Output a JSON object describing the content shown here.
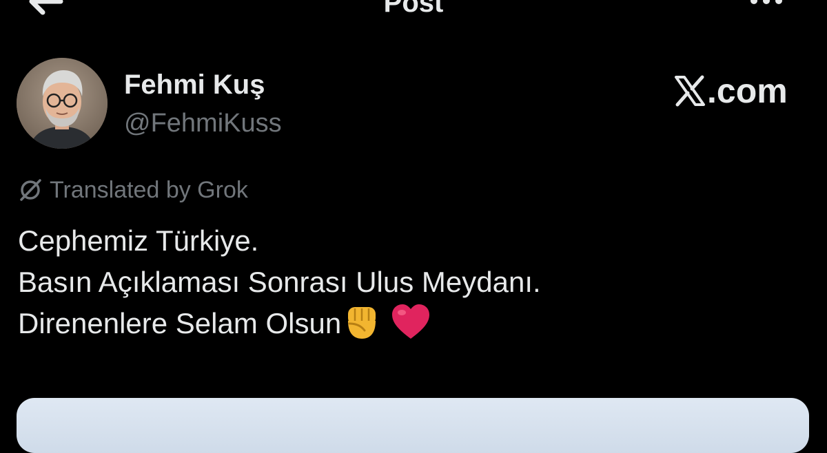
{
  "header": {
    "title": "Post",
    "back_icon": "arrow-left-icon",
    "more_icon": "ellipsis-icon"
  },
  "author": {
    "display_name": "Fehmi Kuş",
    "handle": "@FehmiKuss",
    "avatar_icon": "user-avatar"
  },
  "badge": {
    "logo_icon": "x-logo-icon",
    "label": ".com"
  },
  "translation": {
    "icon": "grok-icon",
    "label": "Translated by Grok"
  },
  "post": {
    "line1": "Cephemiz Türkiye.",
    "line2": "Basın Açıklaması Sonrası Ulus Meydanı.",
    "line3": "Direnenlere Selam Olsun",
    "emojis": [
      "raised-fist-emoji",
      "red-heart-emoji"
    ]
  },
  "colors": {
    "background": "#000000",
    "primary_text": "#e7e9ea",
    "secondary_text": "#71767b",
    "heart": "#e0245e"
  }
}
